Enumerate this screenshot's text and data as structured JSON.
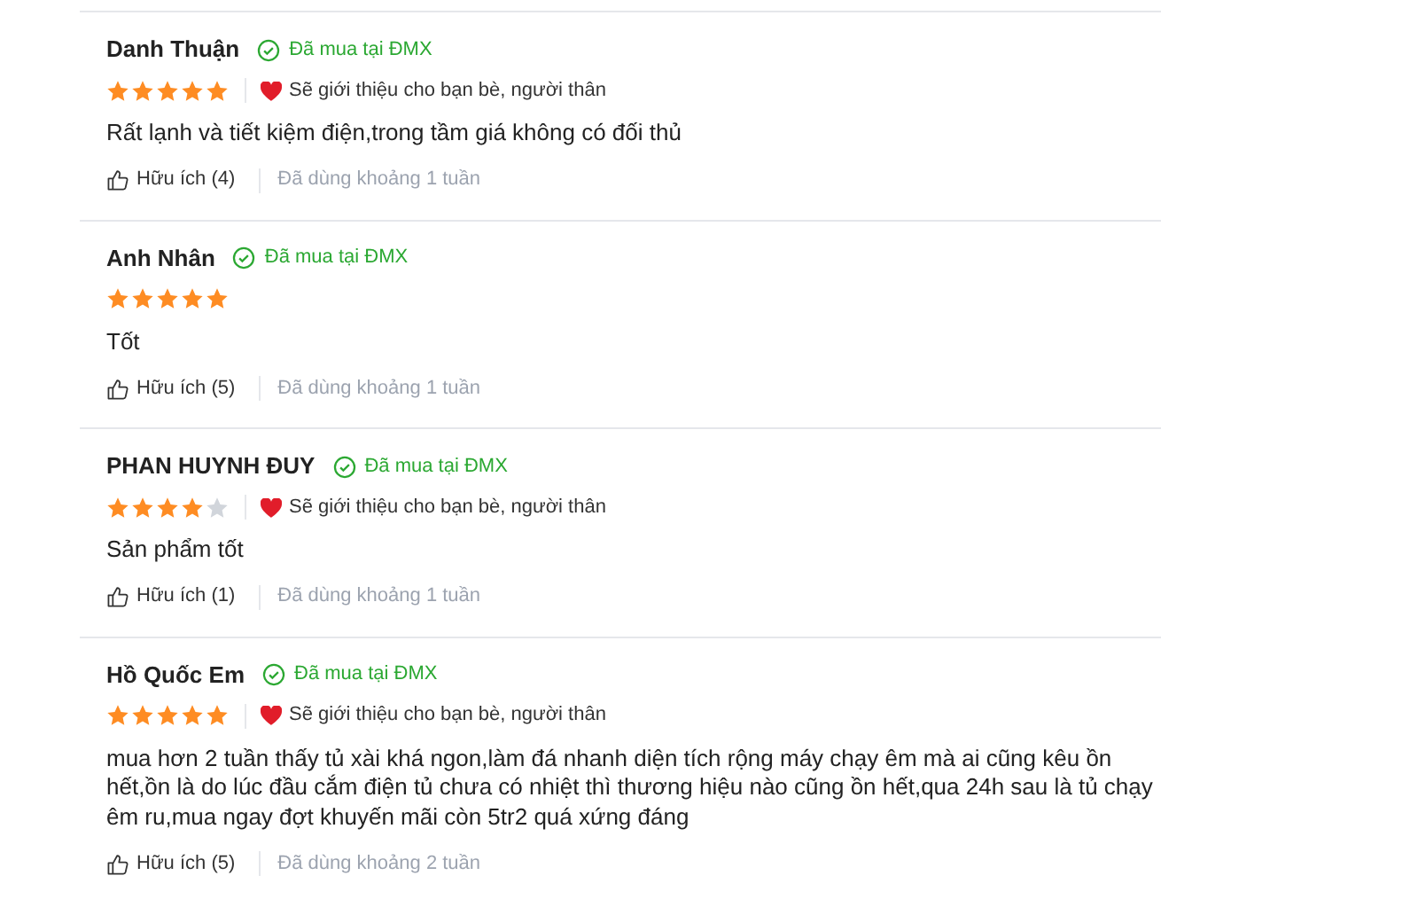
{
  "reviews": [
    {
      "name": "Danh Thuận",
      "verified": "Đã mua tại ĐMX",
      "stars": 5,
      "recommend": "Sẽ giới thiệu cho bạn bè, người thân",
      "comment": "Rất lạnh và tiết kiệm điện,trong tầm giá không có đối thủ",
      "helpful": "Hữu ích (4)",
      "usage": "Đã dùng khoảng 1 tuần"
    },
    {
      "name": "Anh Nhân",
      "verified": "Đã mua tại ĐMX",
      "stars": 5,
      "comment": "Tốt",
      "helpful": "Hữu ích (5)",
      "usage": "Đã dùng khoảng 1 tuần"
    },
    {
      "name": "PHAN HUYNH ĐUY",
      "verified": "Đã mua tại ĐMX",
      "stars": 4,
      "recommend": "Sẽ giới thiệu cho bạn bè, người thân",
      "comment": "Sản phẩm tốt",
      "helpful": "Hữu ích (1)",
      "usage": "Đã dùng khoảng 1 tuần"
    },
    {
      "name": "Hồ Quốc Em",
      "verified": "Đã mua tại ĐMX",
      "stars": 5,
      "recommend": "Sẽ giới thiệu cho bạn bè, người thân",
      "comment": "mua hơn 2 tuần thấy tủ xài khá ngon,làm đá nhanh diện tích rộng máy chạy êm mà ai cũng kêu ồn hết,ồn là do lúc đầu cắm điện tủ chưa có nhiệt thì thương hiệu nào cũng ồn hết,qua 24h sau là tủ chạy êm ru,mua ngay đợt khuyến mãi còn 5tr2 quá xứng đáng",
      "helpful": "Hữu ích (5)",
      "usage": "Đã dùng khoảng 2 tuần"
    }
  ]
}
